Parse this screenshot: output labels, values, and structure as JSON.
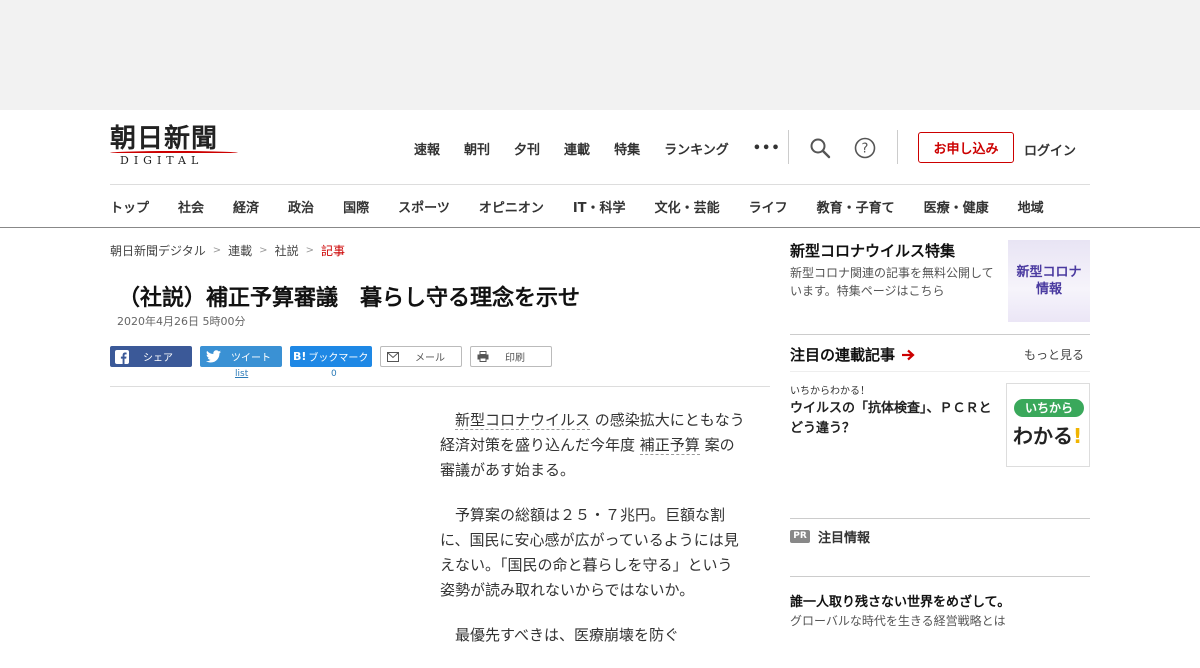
{
  "logo": {
    "kanji": "朝日新聞",
    "sub": "DIGITAL"
  },
  "topnav": [
    "速報",
    "朝刊",
    "夕刊",
    "連載",
    "特集",
    "ランキング",
    "•••"
  ],
  "header": {
    "apply_label": "お申し込み",
    "login_label": "ログイン"
  },
  "catnav": [
    "トップ",
    "社会",
    "経済",
    "政治",
    "国際",
    "スポーツ",
    "オピニオン",
    "IT・科学",
    "文化・芸能",
    "ライフ",
    "教育・子育て",
    "医療・健康",
    "地域"
  ],
  "breadcrumb": [
    "朝日新聞デジタル",
    "連載",
    "社説",
    "記事"
  ],
  "article": {
    "title": "（社説）補正予算審議　暮らし守る理念を示せ",
    "date": "2020年4月26日 5時00分",
    "p1_link1": "新型コロナウイルス",
    "p1_text1": " の感染拡大にともなう経済対策を盛り込んだ今年度 ",
    "p1_link2": "補正予算",
    "p1_text2": " 案の審議があす始まる。",
    "p2": "予算案の総額は２５・７兆円。巨額な割に、国民に安心感が広がっているようには見えない。「国民の命と暮らしを守る」という姿勢が読み取れないからではないか。",
    "p3": "最優先すべきは、医療崩壊を防ぐ"
  },
  "share": {
    "facebook": "シェア",
    "twitter": "ツイート",
    "twitter_count": "list",
    "hatena": "ブックマーク",
    "hatena_count": "0",
    "mail": "メール",
    "print": "印刷"
  },
  "sidebar": {
    "corona_title": "新型コロナウイルス特集",
    "corona_desc": "新型コロナ関連の記事を無料公開しています。特集ページはこちら",
    "corona_thumb": [
      "新型コロナ",
      "情報"
    ],
    "series_head": "注目の連載記事",
    "more": "もっと見る",
    "series_kicker": "いちからわかる！",
    "series_text": "ウイルスの「抗体検査」、ＰＣＲとどう違う？",
    "series_thumb_pill": "いちから",
    "series_thumb_big": "わかる",
    "series_thumb_mark": "!",
    "pr_badge": "PR",
    "pr_label": "注目情報",
    "pr_title": "誰一人取り残さない世界をめざして。",
    "pr_desc": "グローバルな時代を生きる経営戦略とは"
  },
  "colors": {
    "accent": "#cc0000",
    "facebook": "#3b5998",
    "twitter": "#3a91d4",
    "hatena": "#1e88e5"
  }
}
